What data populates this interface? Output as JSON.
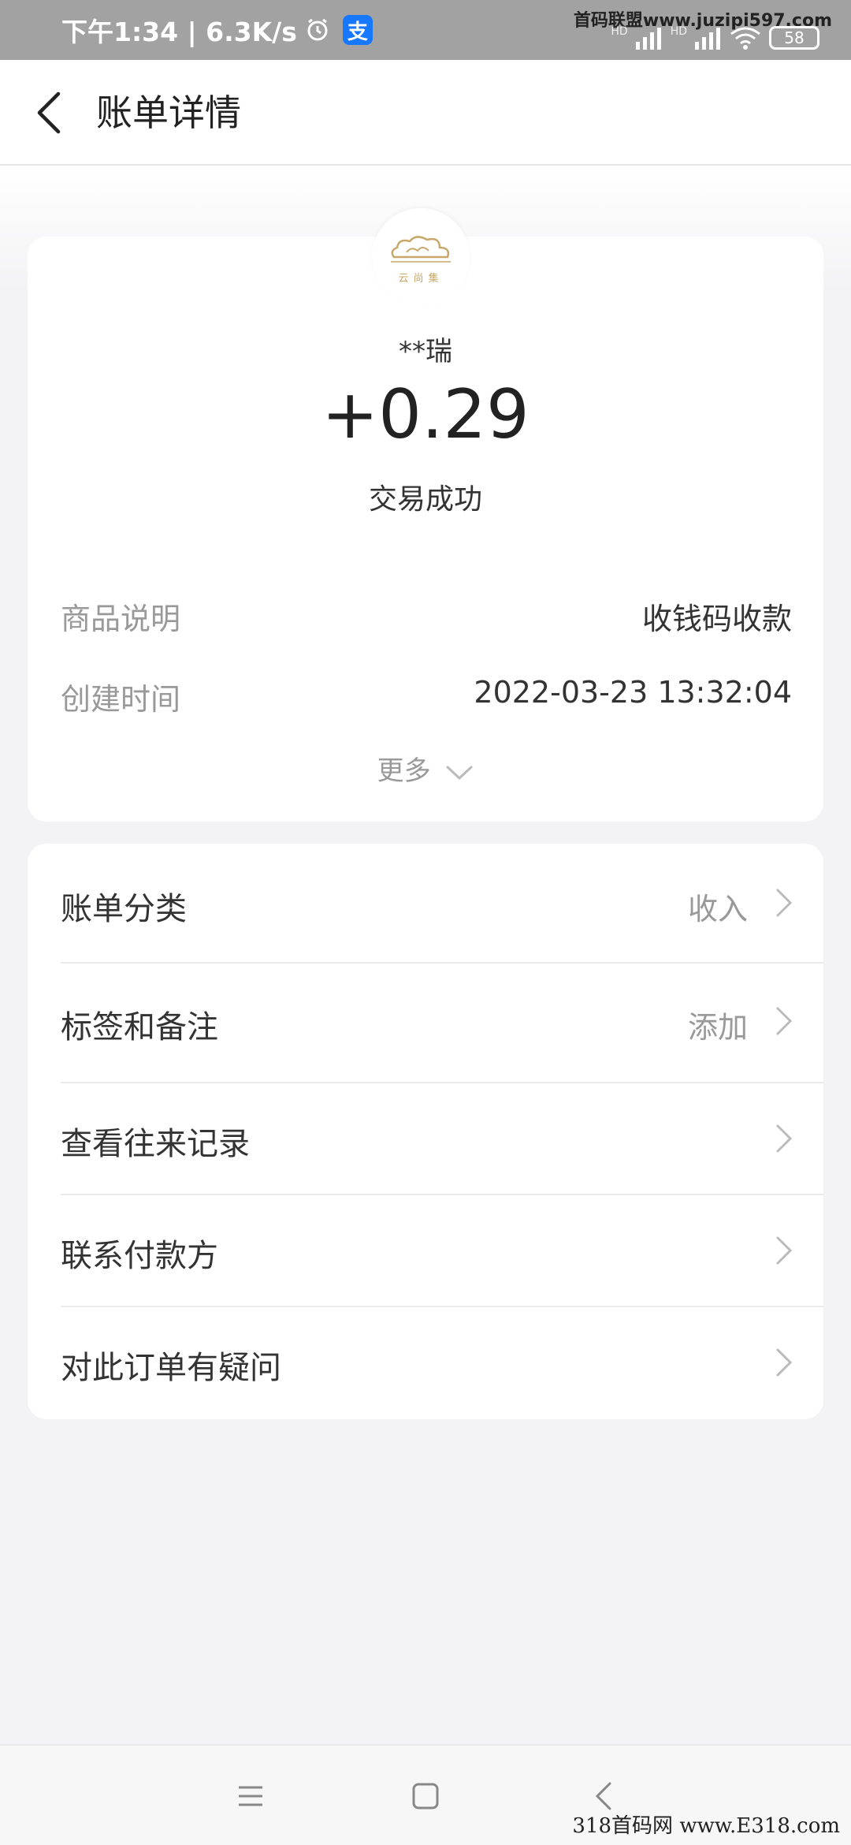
{
  "status_bar": {
    "time_speed": "下午1:34 | 6.3K/s",
    "alipay_glyph": "支",
    "battery": "58",
    "hd1": "HD",
    "hd2": "HD",
    "watermark": "首码联盟www.juzipi597.com"
  },
  "header": {
    "title": "账单详情"
  },
  "logo": {
    "text": "云尚集"
  },
  "transaction": {
    "payer": "**瑞",
    "amount": "+0.29",
    "status": "交易成功",
    "details": [
      {
        "label": "商品说明",
        "value": "收钱码收款"
      },
      {
        "label": "创建时间",
        "value": "2022-03-23 13:32:04"
      }
    ],
    "more_label": "更多"
  },
  "actions": [
    {
      "label": "账单分类",
      "value": "收入"
    },
    {
      "label": "标签和备注",
      "value": "添加"
    },
    {
      "label": "查看往来记录",
      "value": ""
    },
    {
      "label": "联系付款方",
      "value": ""
    },
    {
      "label": "对此订单有疑问",
      "value": ""
    }
  ],
  "watermark_bottom": "318首码网 www.E318.com",
  "colors": {
    "accent": "#1677ff",
    "background": "#f3f3f5",
    "muted_text": "#999999",
    "logo_gold": "#c8a76a"
  }
}
